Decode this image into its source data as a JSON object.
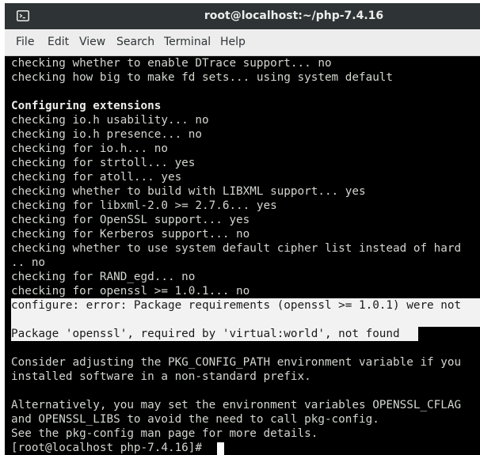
{
  "window": {
    "title": "root@localhost:~/php-7.4.16"
  },
  "icons": {
    "app": "terminal-icon"
  },
  "menu": {
    "items": [
      "File",
      "Edit",
      "View",
      "Search",
      "Terminal",
      "Help"
    ]
  },
  "terminal": {
    "lines": [
      "checking whether to enable DTrace support... no",
      "checking how big to make fd sets... using system default",
      "",
      "Configuring extensions",
      "checking io.h usability... no",
      "checking io.h presence... no",
      "checking for io.h... no",
      "checking for strtoll... yes",
      "checking for atoll... yes",
      "checking whether to build with LIBXML support... yes",
      "checking for libxml-2.0 >= 2.7.6... yes",
      "checking for OpenSSL support... yes",
      "checking for Kerberos support... no",
      "checking whether to use system default cipher list instead of hard",
      ".. no",
      "checking for RAND_egd... no",
      "checking for openssl >= 1.0.1... no",
      "configure: error: Package requirements (openssl >= 1.0.1) were not",
      "",
      "Package 'openssl', required by 'virtual:world', not found",
      "",
      "Consider adjusting the PKG_CONFIG_PATH environment variable if you",
      "installed software in a non-standard prefix.",
      "",
      "Alternatively, you may set the environment variables OPENSSL_CFLAG",
      "and OPENSSL_LIBS to avoid the need to call pkg-config.",
      "See the pkg-config man page for more details.",
      "[root@localhost php-7.4.16]# "
    ]
  },
  "colors": {
    "titlebar": "#2e3436",
    "menubar": "#ededed",
    "terminal_bg": "#000000",
    "terminal_fg": "#d3d7cf",
    "selection": "#f2f2f2"
  }
}
